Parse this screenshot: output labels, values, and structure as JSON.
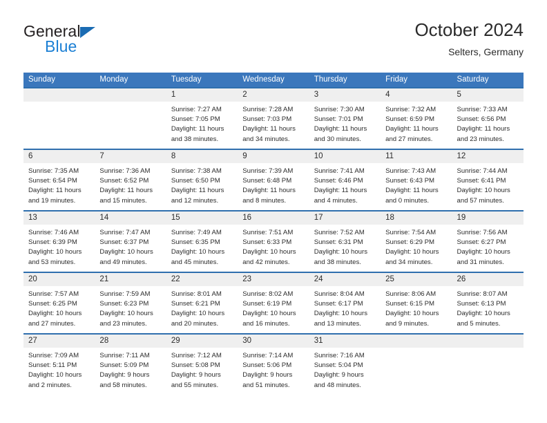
{
  "brand": {
    "name_top": "General",
    "name_bottom": "Blue",
    "triangle_color": "#1b6cb3",
    "blue_color": "#1b7fd4"
  },
  "header": {
    "title": "October 2024",
    "subtitle": "Selters, Germany",
    "accent_color": "#3b77bc",
    "row_border_color": "#2f6fae",
    "daynum_bg": "#efefef"
  },
  "weekday_headers": [
    "Sunday",
    "Monday",
    "Tuesday",
    "Wednesday",
    "Thursday",
    "Friday",
    "Saturday"
  ],
  "labels": {
    "sunrise": "Sunrise:",
    "sunset": "Sunset:",
    "daylight": "Daylight:"
  },
  "weeks": [
    [
      {
        "day": "",
        "l1": "",
        "l2": "",
        "l3": "",
        "l4": ""
      },
      {
        "day": "",
        "l1": "",
        "l2": "",
        "l3": "",
        "l4": ""
      },
      {
        "day": "1",
        "l1": "Sunrise: 7:27 AM",
        "l2": "Sunset: 7:05 PM",
        "l3": "Daylight: 11 hours",
        "l4": "and 38 minutes."
      },
      {
        "day": "2",
        "l1": "Sunrise: 7:28 AM",
        "l2": "Sunset: 7:03 PM",
        "l3": "Daylight: 11 hours",
        "l4": "and 34 minutes."
      },
      {
        "day": "3",
        "l1": "Sunrise: 7:30 AM",
        "l2": "Sunset: 7:01 PM",
        "l3": "Daylight: 11 hours",
        "l4": "and 30 minutes."
      },
      {
        "day": "4",
        "l1": "Sunrise: 7:32 AM",
        "l2": "Sunset: 6:59 PM",
        "l3": "Daylight: 11 hours",
        "l4": "and 27 minutes."
      },
      {
        "day": "5",
        "l1": "Sunrise: 7:33 AM",
        "l2": "Sunset: 6:56 PM",
        "l3": "Daylight: 11 hours",
        "l4": "and 23 minutes."
      }
    ],
    [
      {
        "day": "6",
        "l1": "Sunrise: 7:35 AM",
        "l2": "Sunset: 6:54 PM",
        "l3": "Daylight: 11 hours",
        "l4": "and 19 minutes."
      },
      {
        "day": "7",
        "l1": "Sunrise: 7:36 AM",
        "l2": "Sunset: 6:52 PM",
        "l3": "Daylight: 11 hours",
        "l4": "and 15 minutes."
      },
      {
        "day": "8",
        "l1": "Sunrise: 7:38 AM",
        "l2": "Sunset: 6:50 PM",
        "l3": "Daylight: 11 hours",
        "l4": "and 12 minutes."
      },
      {
        "day": "9",
        "l1": "Sunrise: 7:39 AM",
        "l2": "Sunset: 6:48 PM",
        "l3": "Daylight: 11 hours",
        "l4": "and 8 minutes."
      },
      {
        "day": "10",
        "l1": "Sunrise: 7:41 AM",
        "l2": "Sunset: 6:46 PM",
        "l3": "Daylight: 11 hours",
        "l4": "and 4 minutes."
      },
      {
        "day": "11",
        "l1": "Sunrise: 7:43 AM",
        "l2": "Sunset: 6:43 PM",
        "l3": "Daylight: 11 hours",
        "l4": "and 0 minutes."
      },
      {
        "day": "12",
        "l1": "Sunrise: 7:44 AM",
        "l2": "Sunset: 6:41 PM",
        "l3": "Daylight: 10 hours",
        "l4": "and 57 minutes."
      }
    ],
    [
      {
        "day": "13",
        "l1": "Sunrise: 7:46 AM",
        "l2": "Sunset: 6:39 PM",
        "l3": "Daylight: 10 hours",
        "l4": "and 53 minutes."
      },
      {
        "day": "14",
        "l1": "Sunrise: 7:47 AM",
        "l2": "Sunset: 6:37 PM",
        "l3": "Daylight: 10 hours",
        "l4": "and 49 minutes."
      },
      {
        "day": "15",
        "l1": "Sunrise: 7:49 AM",
        "l2": "Sunset: 6:35 PM",
        "l3": "Daylight: 10 hours",
        "l4": "and 45 minutes."
      },
      {
        "day": "16",
        "l1": "Sunrise: 7:51 AM",
        "l2": "Sunset: 6:33 PM",
        "l3": "Daylight: 10 hours",
        "l4": "and 42 minutes."
      },
      {
        "day": "17",
        "l1": "Sunrise: 7:52 AM",
        "l2": "Sunset: 6:31 PM",
        "l3": "Daylight: 10 hours",
        "l4": "and 38 minutes."
      },
      {
        "day": "18",
        "l1": "Sunrise: 7:54 AM",
        "l2": "Sunset: 6:29 PM",
        "l3": "Daylight: 10 hours",
        "l4": "and 34 minutes."
      },
      {
        "day": "19",
        "l1": "Sunrise: 7:56 AM",
        "l2": "Sunset: 6:27 PM",
        "l3": "Daylight: 10 hours",
        "l4": "and 31 minutes."
      }
    ],
    [
      {
        "day": "20",
        "l1": "Sunrise: 7:57 AM",
        "l2": "Sunset: 6:25 PM",
        "l3": "Daylight: 10 hours",
        "l4": "and 27 minutes."
      },
      {
        "day": "21",
        "l1": "Sunrise: 7:59 AM",
        "l2": "Sunset: 6:23 PM",
        "l3": "Daylight: 10 hours",
        "l4": "and 23 minutes."
      },
      {
        "day": "22",
        "l1": "Sunrise: 8:01 AM",
        "l2": "Sunset: 6:21 PM",
        "l3": "Daylight: 10 hours",
        "l4": "and 20 minutes."
      },
      {
        "day": "23",
        "l1": "Sunrise: 8:02 AM",
        "l2": "Sunset: 6:19 PM",
        "l3": "Daylight: 10 hours",
        "l4": "and 16 minutes."
      },
      {
        "day": "24",
        "l1": "Sunrise: 8:04 AM",
        "l2": "Sunset: 6:17 PM",
        "l3": "Daylight: 10 hours",
        "l4": "and 13 minutes."
      },
      {
        "day": "25",
        "l1": "Sunrise: 8:06 AM",
        "l2": "Sunset: 6:15 PM",
        "l3": "Daylight: 10 hours",
        "l4": "and 9 minutes."
      },
      {
        "day": "26",
        "l1": "Sunrise: 8:07 AM",
        "l2": "Sunset: 6:13 PM",
        "l3": "Daylight: 10 hours",
        "l4": "and 5 minutes."
      }
    ],
    [
      {
        "day": "27",
        "l1": "Sunrise: 7:09 AM",
        "l2": "Sunset: 5:11 PM",
        "l3": "Daylight: 10 hours",
        "l4": "and 2 minutes."
      },
      {
        "day": "28",
        "l1": "Sunrise: 7:11 AM",
        "l2": "Sunset: 5:09 PM",
        "l3": "Daylight: 9 hours",
        "l4": "and 58 minutes."
      },
      {
        "day": "29",
        "l1": "Sunrise: 7:12 AM",
        "l2": "Sunset: 5:08 PM",
        "l3": "Daylight: 9 hours",
        "l4": "and 55 minutes."
      },
      {
        "day": "30",
        "l1": "Sunrise: 7:14 AM",
        "l2": "Sunset: 5:06 PM",
        "l3": "Daylight: 9 hours",
        "l4": "and 51 minutes."
      },
      {
        "day": "31",
        "l1": "Sunrise: 7:16 AM",
        "l2": "Sunset: 5:04 PM",
        "l3": "Daylight: 9 hours",
        "l4": "and 48 minutes."
      },
      {
        "day": "",
        "l1": "",
        "l2": "",
        "l3": "",
        "l4": ""
      },
      {
        "day": "",
        "l1": "",
        "l2": "",
        "l3": "",
        "l4": ""
      }
    ]
  ]
}
